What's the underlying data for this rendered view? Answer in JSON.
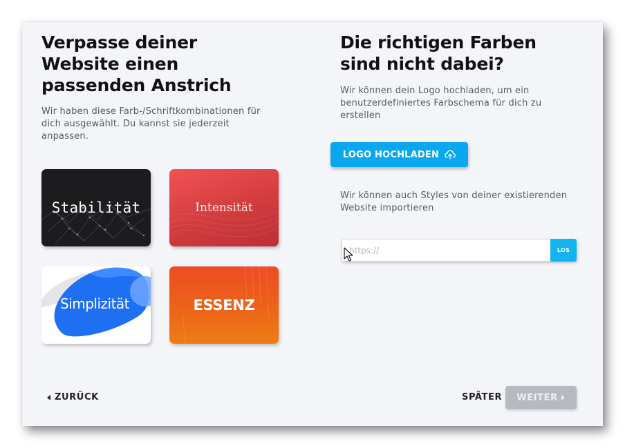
{
  "left": {
    "heading": "Verpasse deiner\nWebsite einen\npassenden Anstrich",
    "description": "Wir haben diese Farb-/Schriftkombinationen für dich ausgewählt. Du kannst sie jederzeit anpassen."
  },
  "themes": [
    {
      "label": "Stabilität",
      "style": "dark network mesh"
    },
    {
      "label": "Intensität",
      "style": "red gradient waves"
    },
    {
      "label": "Simplizität",
      "style": "blue blob"
    },
    {
      "label": "ESSENZ",
      "style": "orange gradient"
    }
  ],
  "right": {
    "heading": "Die richtigen Farben\nsind nicht dabei?",
    "description": "Wir können dein Logo hochladen, um ein benutzerdefiniertes Farbschema für dich zu erstellen",
    "upload_label": "LOGO HOCHLADEN",
    "upload_icon": "cloud-upload-icon",
    "import_description": "Wir können auch Styles von deiner existierenden Website importieren",
    "url_placeholder": "https://",
    "url_value": "",
    "url_submit_label": "LOS"
  },
  "footer": {
    "back_label": "ZURÜCK",
    "later_label": "SPÄTER",
    "next_label": "WEITER"
  },
  "colors": {
    "accent": "#0aa7ee",
    "disabled": "#b6bac0",
    "panel": "#f4f5f9"
  }
}
